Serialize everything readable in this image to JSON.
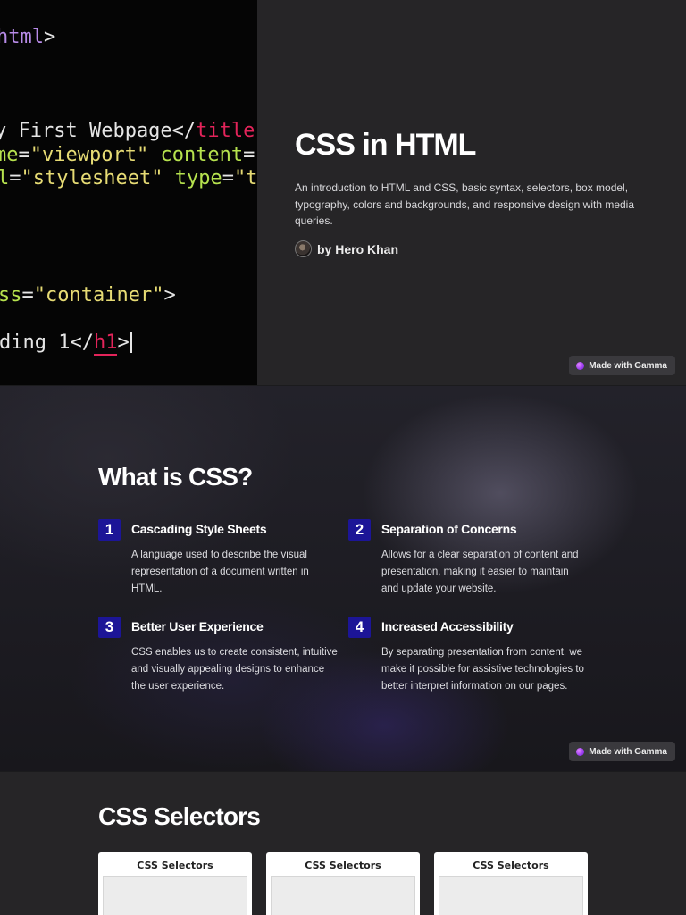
{
  "slide1": {
    "code_lines": [
      {
        "parts": [
          {
            "t": "html",
            "c": "c-purple"
          },
          {
            "t": ">",
            "c": "c-white"
          }
        ]
      },
      {
        "parts": [
          {
            "t": "y First Webpage</",
            "c": "c-white"
          },
          {
            "t": "title",
            "c": "c-red"
          }
        ]
      },
      {
        "parts": [
          {
            "t": "me",
            "c": "c-green"
          },
          {
            "t": "=",
            "c": "c-white"
          },
          {
            "t": "\"viewport\"",
            "c": "c-yellow"
          },
          {
            "t": " content",
            "c": "c-green"
          },
          {
            "t": "=",
            "c": "c-white"
          }
        ]
      },
      {
        "parts": [
          {
            "t": "l",
            "c": "c-green"
          },
          {
            "t": "=",
            "c": "c-white"
          },
          {
            "t": "\"stylesheet\"",
            "c": "c-yellow"
          },
          {
            "t": " type",
            "c": "c-green"
          },
          {
            "t": "=",
            "c": "c-white"
          },
          {
            "t": "\"t",
            "c": "c-yellow"
          }
        ]
      },
      {
        "parts": [
          {
            "t": "ss",
            "c": "c-green"
          },
          {
            "t": "=",
            "c": "c-white"
          },
          {
            "t": "\"container\"",
            "c": "c-yellow"
          },
          {
            "t": ">",
            "c": "c-white"
          }
        ]
      },
      {
        "parts": [
          {
            "t": "ding 1</",
            "c": "c-white"
          },
          {
            "t": "h1",
            "c": "c-red"
          },
          {
            "t": ">",
            "c": "c-white"
          }
        ]
      }
    ],
    "title": "CSS in HTML",
    "description": "An introduction to HTML and CSS, basic syntax, selectors, box model, typography, colors and backgrounds, and responsive design with media queries.",
    "author": "by Hero Khan",
    "badge": "Made with Gamma"
  },
  "slide2": {
    "title": "What is CSS?",
    "points": [
      {
        "num": "1",
        "title": "Cascading Style Sheets",
        "text": "A language used to describe the visual representation of a document written in HTML."
      },
      {
        "num": "2",
        "title": "Separation of Concerns",
        "text": "Allows for a clear separation of content and presentation, making it easier to maintain and update your website."
      },
      {
        "num": "3",
        "title": "Better User Experience",
        "text": "CSS enables us to create consistent, intuitive and visually appealing designs to enhance the user experience."
      },
      {
        "num": "4",
        "title": "Increased Accessibility",
        "text": "By separating presentation from content, we make it possible for assistive technologies to better interpret information on our pages."
      }
    ],
    "badge": "Made with Gamma"
  },
  "slide3": {
    "title": "CSS Selectors",
    "cards": [
      {
        "title": "CSS Selectors"
      },
      {
        "title": "CSS Selectors"
      },
      {
        "title": "CSS Selectors"
      }
    ]
  },
  "colors": {
    "number_badge": "#1c1597",
    "gamma_accent": "#9b3df0"
  }
}
